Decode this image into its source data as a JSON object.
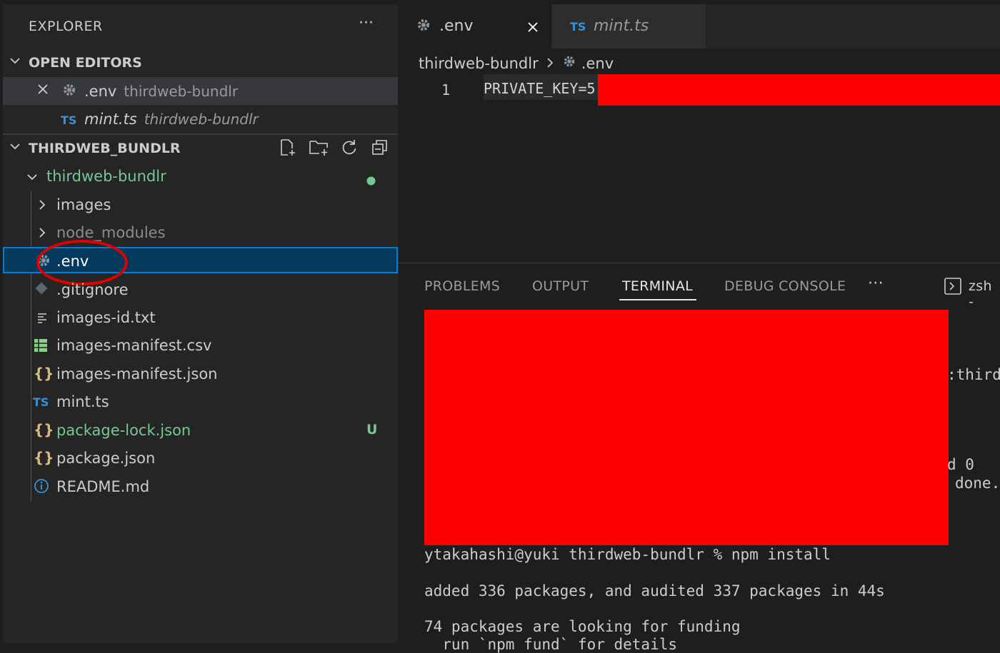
{
  "explorer": {
    "title": "EXPLORER",
    "more": "···",
    "open_editors": {
      "label": "OPEN EDITORS",
      "items": [
        {
          "name": ".env",
          "path": "thirdweb-bundlr"
        },
        {
          "icon_text": "TS",
          "name": "mint.ts",
          "path": "thirdweb-bundlr"
        }
      ]
    },
    "workspace": {
      "label": "THIRDWEB_BUNDLR",
      "root": "thirdweb-bundlr",
      "items": [
        {
          "label": "images"
        },
        {
          "label": "node_modules"
        },
        {
          "label": ".env"
        },
        {
          "label": ".gitignore"
        },
        {
          "label": "images-id.txt"
        },
        {
          "label": "images-manifest.csv"
        },
        {
          "label": "images-manifest.json",
          "icon_text": "{}"
        },
        {
          "label": "mint.ts",
          "icon_text": "TS"
        },
        {
          "label": "package-lock.json",
          "icon_text": "{}",
          "badge": "U"
        },
        {
          "label": "package.json",
          "icon_text": "{}"
        },
        {
          "label": "README.md"
        }
      ]
    }
  },
  "editor": {
    "tabs": [
      {
        "label": ".env"
      },
      {
        "icon_text": "TS",
        "label": "mint.ts"
      }
    ],
    "breadcrumb": {
      "folder": "thirdweb-bundlr",
      "file": ".env"
    },
    "line_number": "1",
    "code": "PRIVATE_KEY=5"
  },
  "panel": {
    "tabs": [
      {
        "label": "PROBLEMS"
      },
      {
        "label": "OUTPUT"
      },
      {
        "label": "TERMINAL"
      },
      {
        "label": "DEBUG CONSOLE"
      }
    ],
    "more": "···",
    "shell": "zsh -",
    "terminal": {
      "partial_1": ":third",
      "partial_2": "d 0",
      "partial_3": "done.",
      "prompt_line": "ytakahashi@yuki thirdweb-bundlr % npm install",
      "added_line": "added 336 packages, and audited 337 packages in 44s",
      "funding_line": "74 packages are looking for funding",
      "cutoff_line": "  run `npm fund` for details"
    }
  },
  "colors": {
    "selection": "#04395e",
    "selection_border": "#007fd4",
    "untracked": "#73c991",
    "redaction": "#ff0000"
  }
}
